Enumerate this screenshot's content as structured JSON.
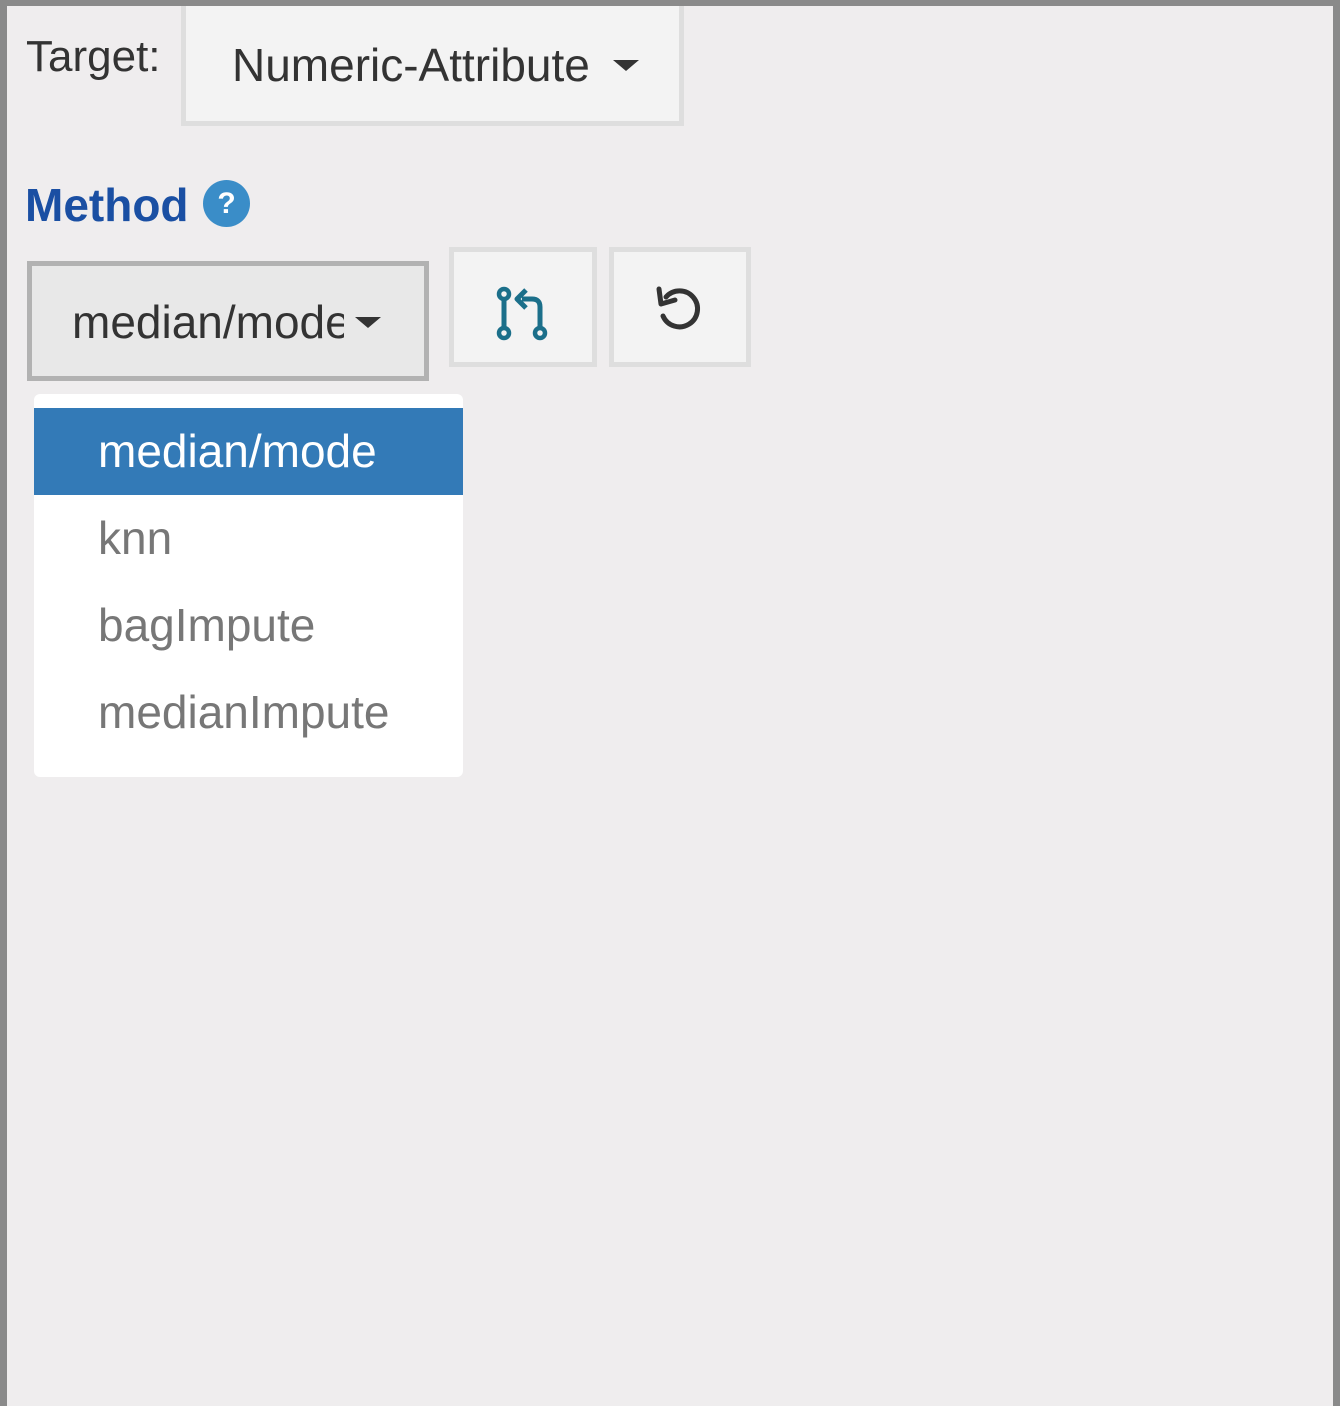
{
  "target": {
    "label": "Target:",
    "selected": "Numeric-Attribute"
  },
  "method": {
    "heading": "Method",
    "help_icon": "?",
    "selected": "median/mode",
    "options": [
      "median/mode",
      "knn",
      "bagImpute",
      "medianImpute"
    ]
  },
  "buttons": {
    "compare_icon": "git-pull-request-icon",
    "reset_icon": "undo-icon"
  },
  "colors": {
    "accent": "#1a4fa3",
    "selected_option": "#337ab7",
    "help_icon": "#3a8dc8",
    "compare_icon": "#1b6f8a"
  }
}
